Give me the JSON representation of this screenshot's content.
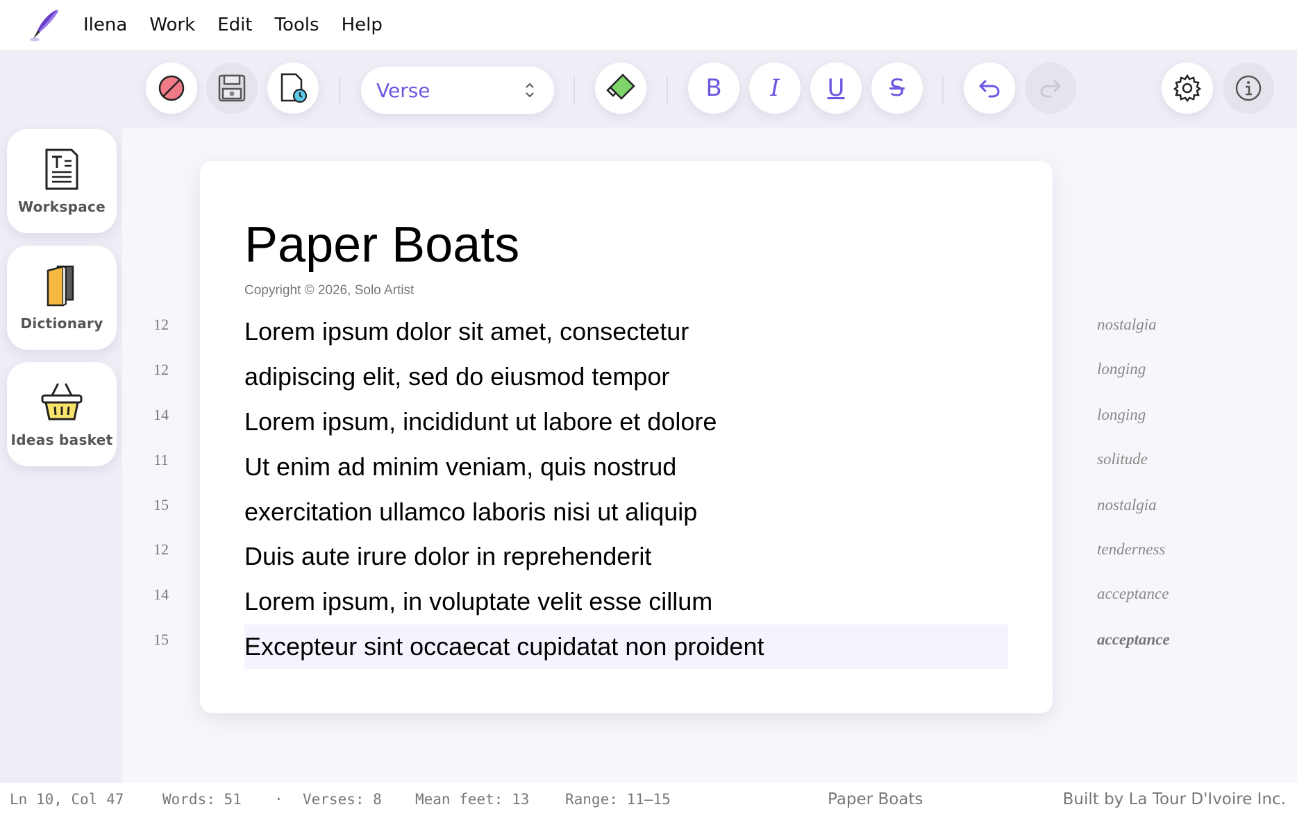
{
  "menu": {
    "items": [
      "Ilena",
      "Work",
      "Edit",
      "Tools",
      "Help"
    ]
  },
  "toolbar": {
    "style_select": {
      "value": "Verse"
    },
    "bold_label": "B",
    "italic_label": "I",
    "underline_label": "U",
    "strike_label": "S",
    "redo_enabled": false
  },
  "sidebar": {
    "items": [
      {
        "label": "Workspace",
        "icon": "document-icon"
      },
      {
        "label": "Dictionary",
        "icon": "book-icon"
      },
      {
        "label": "Ideas basket",
        "icon": "basket-icon"
      }
    ]
  },
  "document": {
    "title": "Paper Boats",
    "copyright": "Copyright © 2026, Solo Artist",
    "active_line_index": 7,
    "lines": [
      {
        "feet": "12",
        "text": "Lorem ipsum dolor sit amet, consectetur",
        "theme": "nostalgia"
      },
      {
        "feet": "12",
        "text": "adipiscing elit, sed do eiusmod tempor",
        "theme": "longing"
      },
      {
        "feet": "14",
        "text": "Lorem ipsum, incididunt ut labore et dolore",
        "theme": "longing"
      },
      {
        "feet": "11",
        "text": "Ut enim ad minim veniam, quis nostrud",
        "theme": "solitude"
      },
      {
        "feet": "15",
        "text": "exercitation ullamco laboris nisi ut aliquip",
        "theme": "nostalgia"
      },
      {
        "feet": "12",
        "text": "Duis aute irure dolor in reprehenderit",
        "theme": "tenderness"
      },
      {
        "feet": "14",
        "text": "Lorem ipsum, in voluptate velit esse cillum",
        "theme": "acceptance"
      },
      {
        "feet": "15",
        "text": "Excepteur sint occaecat cupidatat non proident",
        "theme": "acceptance"
      }
    ]
  },
  "status": {
    "position": "Ln 10, Col 47",
    "words": "Words: 51",
    "separator": "·",
    "verses": "Verses: 8",
    "mean_feet": "Mean feet: 13",
    "range": "Range: 11–15",
    "document_name": "Paper Boats",
    "credit": "Built by La Tour D'Ivoire Inc."
  },
  "colors": {
    "accent": "#6f55e0",
    "toolbar_bg": "#eeeef6",
    "active_line_bg": "#f5f4fe"
  }
}
